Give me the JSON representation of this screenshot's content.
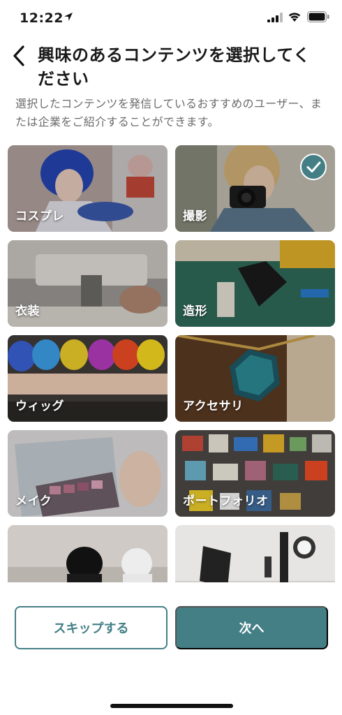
{
  "status_bar": {
    "time": "12:22"
  },
  "header": {
    "title": "興味のあるコンテンツを選択してください",
    "description": "選択したコンテンツを発信しているおすすめのユーザー、または企業をご紹介することができます。"
  },
  "categories": [
    {
      "label": "コスプレ",
      "selected": false
    },
    {
      "label": "撮影",
      "selected": true
    },
    {
      "label": "衣装",
      "selected": false
    },
    {
      "label": "造形",
      "selected": false
    },
    {
      "label": "ウィッグ",
      "selected": false
    },
    {
      "label": "アクセサリ",
      "selected": false
    },
    {
      "label": "メイク",
      "selected": false
    },
    {
      "label": "ポートフォリオ",
      "selected": false
    },
    {
      "label": "",
      "selected": false
    },
    {
      "label": "",
      "selected": false
    }
  ],
  "buttons": {
    "skip": "スキップする",
    "next": "次へ"
  },
  "colors": {
    "accent": "#447f86"
  }
}
